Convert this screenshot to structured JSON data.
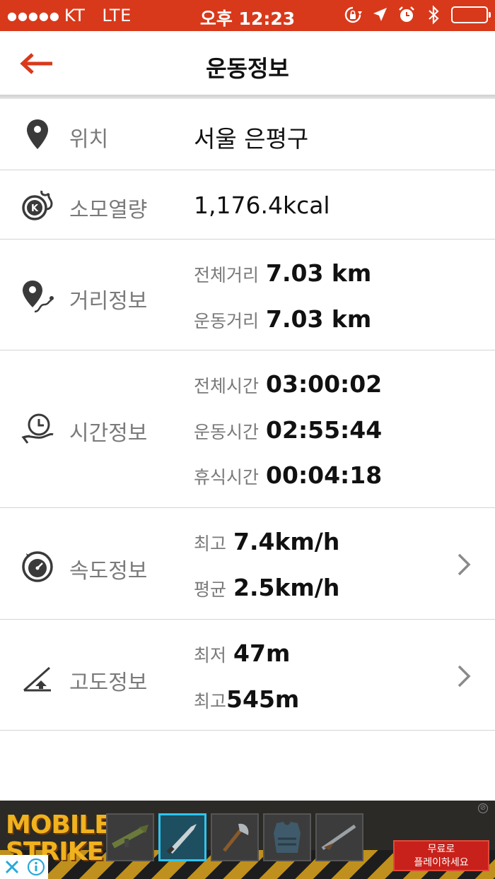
{
  "status_bar": {
    "signal": "●●●●●",
    "carrier": "KT",
    "network": "LTE",
    "time": "오후 12:23",
    "icons": [
      "rotation-lock-icon",
      "location-arrow-icon",
      "alarm-icon",
      "bluetooth-icon",
      "battery-icon"
    ],
    "battery_level": 1.0
  },
  "nav": {
    "title": "운동정보",
    "back_icon": "back-arrow-icon",
    "accent_color": "#d8391b"
  },
  "rows": {
    "location": {
      "icon": "map-pin-icon",
      "label": "위치",
      "value": "서울 은평구"
    },
    "calories": {
      "icon": "calorie-fire-icon",
      "label": "소모열량",
      "value": "1,176.4kcal"
    },
    "distance": {
      "icon": "route-pin-icon",
      "label": "거리정보",
      "total_label": "전체거리",
      "total_value": "7.03 km",
      "exercise_label": "운동거리",
      "exercise_value": "7.03 km"
    },
    "time": {
      "icon": "clock-hand-icon",
      "label": "시간정보",
      "total_label": "전체시간",
      "total_value": "03:00:02",
      "exercise_label": "운동시간",
      "exercise_value": "02:55:44",
      "rest_label": "휴식시간",
      "rest_value": "00:04:18"
    },
    "speed": {
      "icon": "speedometer-icon",
      "label": "속도정보",
      "max_label": "최고",
      "max_value": "7.4km/h",
      "avg_label": "평균",
      "avg_value": "2.5km/h"
    },
    "altitude": {
      "icon": "altitude-icon",
      "label": "고도정보",
      "min_label": "최저",
      "min_value": "47m",
      "max_label": "최고",
      "max_value": "545m"
    }
  },
  "ad": {
    "logo_line1": "MOBILE",
    "logo_line2": "STRIKE",
    "cta_line1": "무료로",
    "cta_line2": "플레이하세요",
    "items": [
      "rocket-launcher-icon",
      "knife-icon",
      "axe-icon",
      "armor-vest-icon",
      "shotgun-icon"
    ]
  }
}
